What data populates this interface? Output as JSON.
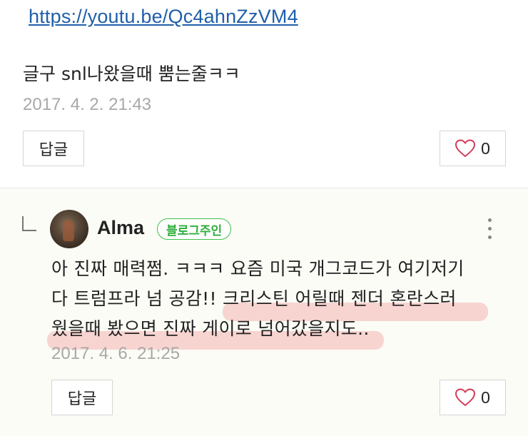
{
  "top_link": "https://youtu.be/Qc4ahnZzVM4",
  "comment1": {
    "text": "글구 snl나왔을때 뿜는줄ㅋㅋ",
    "timestamp": "2017. 4. 2. 21:43",
    "reply_label": "답글",
    "like_count": "0"
  },
  "reply": {
    "author": "Alma",
    "badge": "블로그주인",
    "line1": "아 진짜 매력쩜. ㅋㅋㅋ 요즘 미국 개그코드가 여기저기",
    "line2": "다 트럼프라 넘 공감!! 크리스틴 어릴때 젠더 혼란스러",
    "line3": "웠을때 봤으면 진짜 게이로 넘어갔을지도..",
    "timestamp": "2017. 4. 6. 21:25",
    "reply_label": "답글",
    "like_count": "0"
  },
  "colors": {
    "link": "#1f5faa",
    "badge": "#2fae3b",
    "highlight": "#f6b3b3",
    "heart": "#d33b5a"
  },
  "icons": [
    "heart-icon",
    "reply-arrow-icon",
    "more-vertical-icon"
  ]
}
